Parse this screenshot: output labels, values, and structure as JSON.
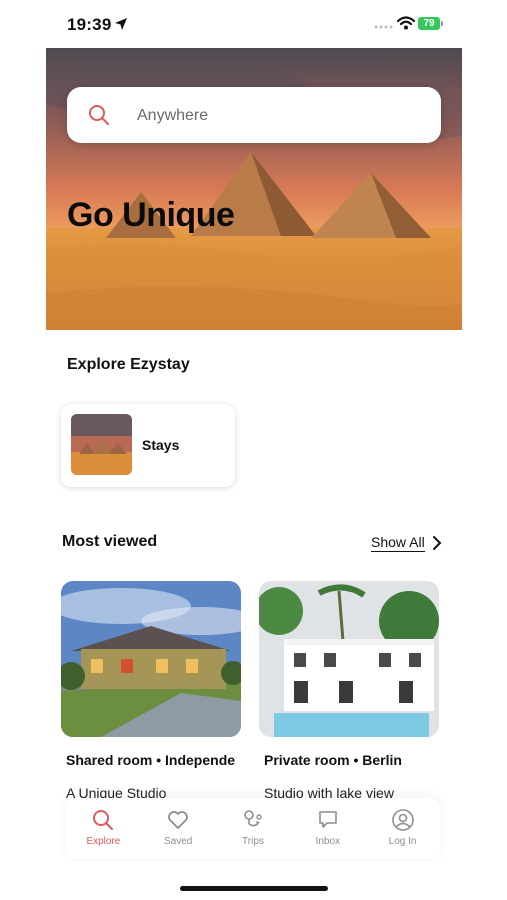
{
  "status_bar": {
    "time": "19:39",
    "battery": "79"
  },
  "hero": {
    "search_placeholder": "Anywhere",
    "title": "Go Unique"
  },
  "explore": {
    "title": "Explore Ezystay",
    "categories": [
      {
        "label": "Stays"
      }
    ]
  },
  "most_viewed": {
    "title": "Most viewed",
    "show_all": "Show All",
    "listings": [
      {
        "meta": "Shared room  •  Independe",
        "name": "A Unique Studio"
      },
      {
        "meta": "Private room  •  Berlin",
        "name": "Studio with lake view"
      }
    ]
  },
  "tab_bar": {
    "tabs": [
      {
        "label": "Explore",
        "icon": "search-icon",
        "active": true
      },
      {
        "label": "Saved",
        "icon": "heart-icon"
      },
      {
        "label": "Trips",
        "icon": "trips-icon"
      },
      {
        "label": "Inbox",
        "icon": "message-icon"
      },
      {
        "label": "Log In",
        "icon": "user-circle-icon"
      }
    ]
  },
  "colors": {
    "accent": "#e05a5a",
    "battery": "#34c759"
  }
}
